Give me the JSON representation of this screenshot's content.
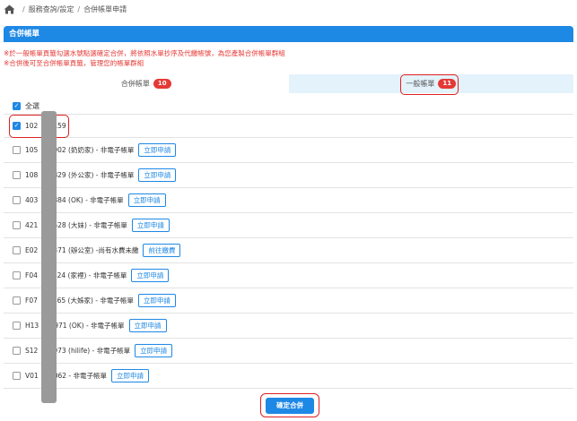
{
  "breadcrumb": {
    "items": [
      "服務查詢/設定",
      "合併帳單申請"
    ],
    "separator": "/"
  },
  "panel": {
    "title": "合併帳單"
  },
  "notices": [
    "※於一般帳單頁籤勾選水號點選確定合併，將依照水單抄序及代繳帳號，為您產製合併帳單群組",
    "※合併後可至合併帳單頁籤，管理您的帳單群組"
  ],
  "tabs": [
    {
      "label": "合併帳單",
      "count": "10"
    },
    {
      "label": "一般帳單",
      "count": "11"
    }
  ],
  "select_all": {
    "label": "全選",
    "checked": true
  },
  "accounts": [
    {
      "text": "102",
      "suffix": "159",
      "checked": true,
      "button": ""
    },
    {
      "text": "105",
      "suffix": "902 (奶奶家) - 非電子帳單",
      "checked": false,
      "button": "立即申請"
    },
    {
      "text": "108",
      "suffix": "829 (外公家) - 非電子帳單",
      "checked": false,
      "button": "立即申請"
    },
    {
      "text": "403",
      "suffix": "884 (OK) - 非電子帳單",
      "checked": false,
      "button": "立即申請"
    },
    {
      "text": "421",
      "suffix": "528 (大妹) - 非電子帳單",
      "checked": false,
      "button": "立即申請"
    },
    {
      "text": "E02",
      "suffix": "371 (辦公室) -尚有水費未繳",
      "checked": false,
      "button": "前往繳費"
    },
    {
      "text": "F04",
      "suffix": "424 (家裡) - 非電子帳單",
      "checked": false,
      "button": "立即申請"
    },
    {
      "text": "F07",
      "suffix": "865 (大姊家) - 非電子帳單",
      "checked": false,
      "button": "立即申請"
    },
    {
      "text": "H13",
      "suffix": "971 (OK) - 非電子帳單",
      "checked": false,
      "button": "立即申請"
    },
    {
      "text": "S12",
      "suffix": "973 (hilife) - 非電子帳單",
      "checked": false,
      "button": "立即申請"
    },
    {
      "text": "V01",
      "suffix": "062 - 非電子帳單",
      "checked": false,
      "button": "立即申請"
    }
  ],
  "confirm_button": "確定合併",
  "colors": {
    "primary": "#1e88e5",
    "alert": "#e53935",
    "highlight": "#e02020"
  }
}
